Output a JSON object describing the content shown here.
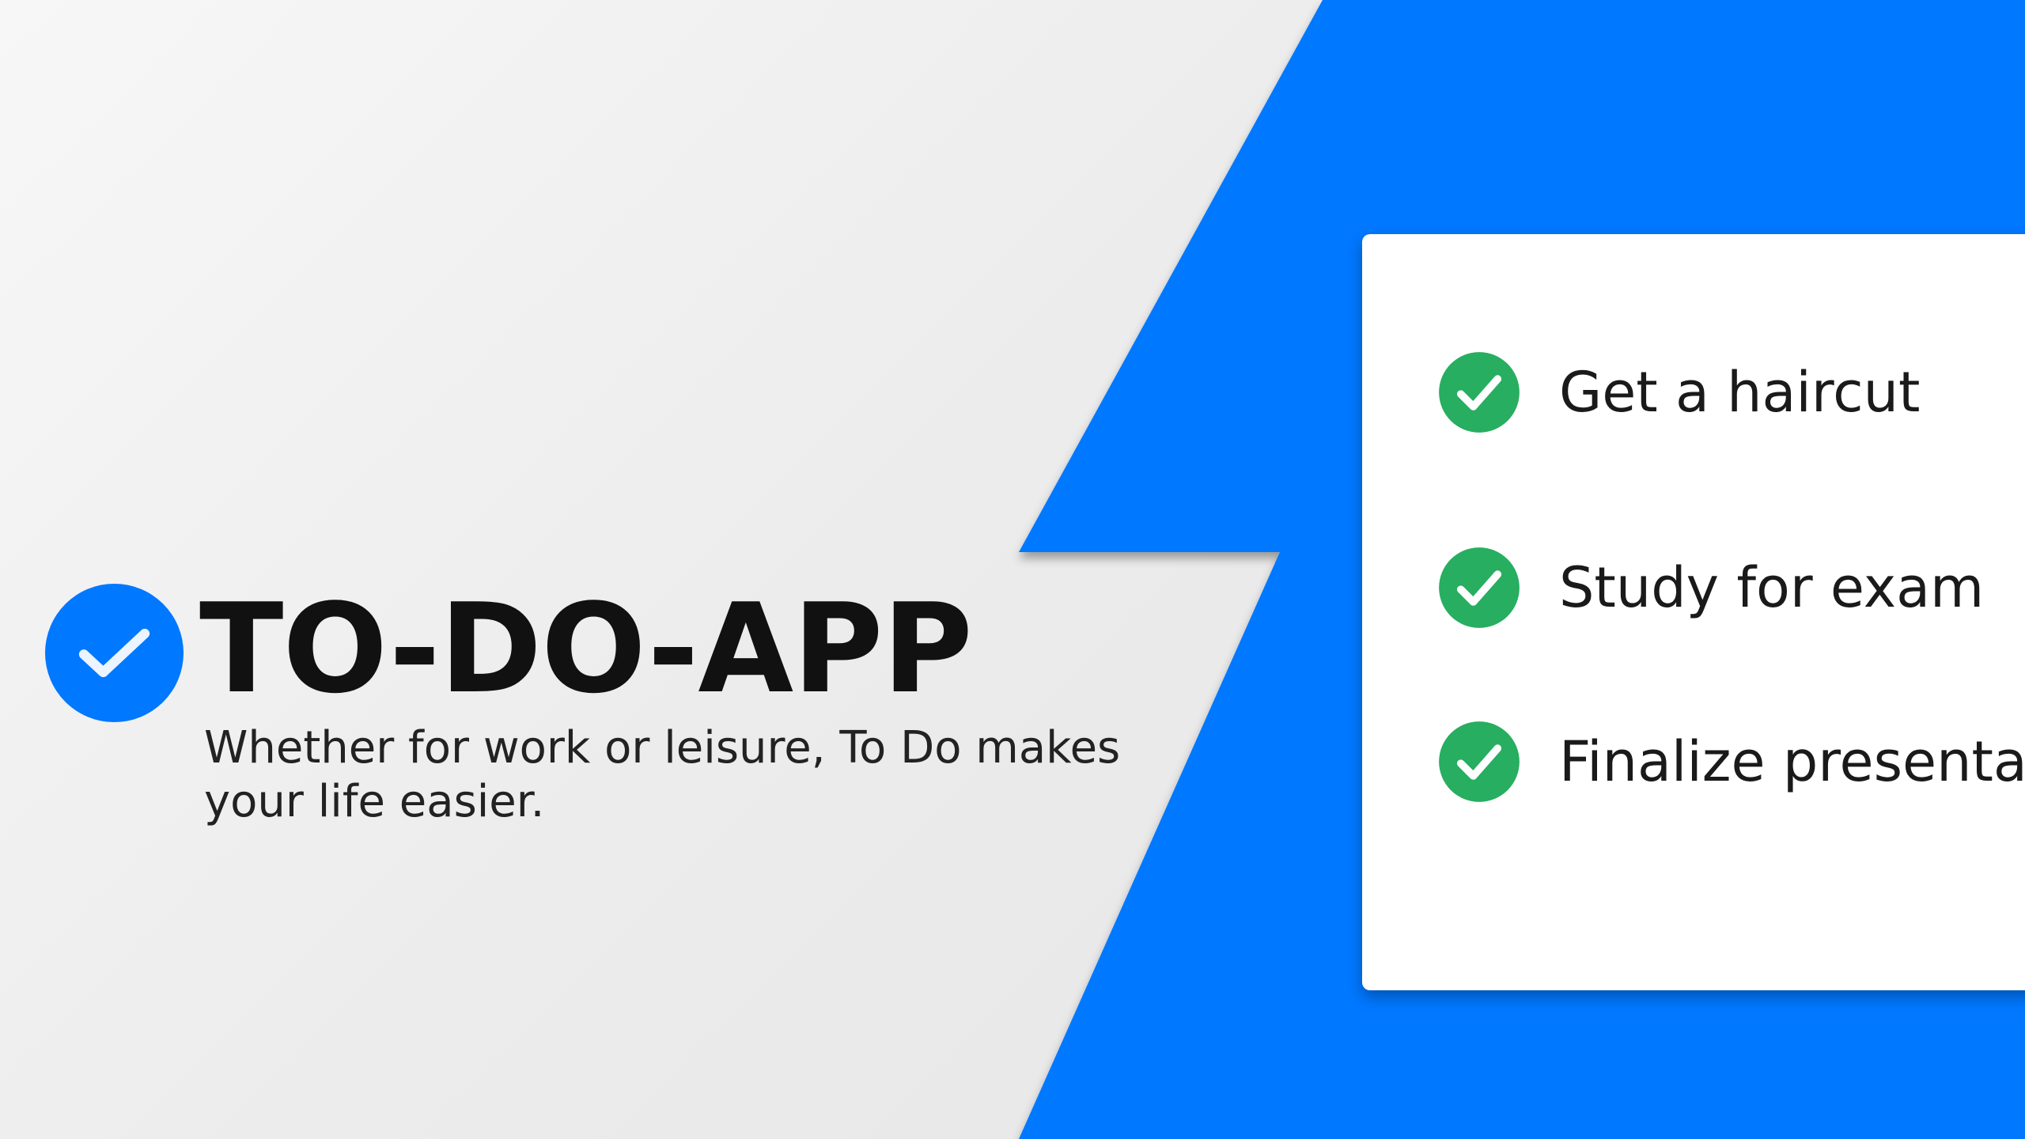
{
  "app": {
    "title": "TO-DO-APP",
    "tagline": "Whether for work or leisure, To Do makes your life easier.",
    "logo_icon": "check-circle-icon"
  },
  "tasks": [
    {
      "label": "Get a haircut",
      "status_icon": "check-circle-icon",
      "done": true
    },
    {
      "label": "Study for exam",
      "status_icon": "check-circle-icon",
      "done": true
    },
    {
      "label": "Finalize presentation",
      "status_icon": "check-circle-icon",
      "done": true
    }
  ],
  "colors": {
    "brand_blue": "#0078FF",
    "done_green": "#27AE60",
    "background": "#EEEEEE",
    "card": "#FFFFFF",
    "title_text": "#111111"
  }
}
